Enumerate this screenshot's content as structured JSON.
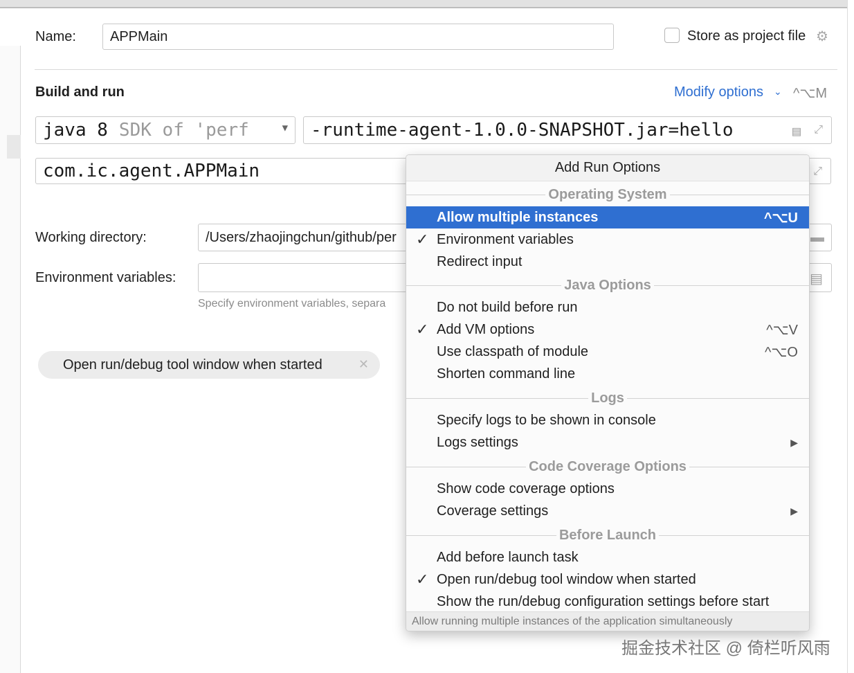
{
  "header": {
    "name_label": "Name:",
    "name_value": "APPMain",
    "store_label": "Store as project file"
  },
  "build": {
    "title": "Build and run",
    "modify_options": "Modify options",
    "modify_shortcut": "^⌥M",
    "jdk_main": "java 8",
    "jdk_hint": "SDK of 'perf",
    "vm_options": "-runtime-agent-1.0.0-SNAPSHOT.jar=hello",
    "main_class": "com.ic.agent.APPMain"
  },
  "working_dir": {
    "label": "Working directory:",
    "value": "/Users/zhaojingchun/github/per"
  },
  "env": {
    "label": "Environment variables:",
    "hint": "Specify environment variables, separa"
  },
  "chip": {
    "label": "Open run/debug tool window when started"
  },
  "popup": {
    "title": "Add Run Options",
    "sections": {
      "os": "Operating System",
      "java": "Java Options",
      "logs": "Logs",
      "coverage": "Code Coverage Options",
      "before": "Before Launch"
    },
    "items": [
      {
        "label": "Allow multiple instances",
        "shortcut": "^⌥U",
        "checked": false,
        "selected": true
      },
      {
        "label": "Environment variables",
        "checked": true
      },
      {
        "label": "Redirect input",
        "checked": false
      },
      {
        "label": "Do not build before run",
        "checked": false
      },
      {
        "label": "Add VM options",
        "shortcut": "^⌥V",
        "checked": true
      },
      {
        "label": "Use classpath of module",
        "shortcut": "^⌥O",
        "checked": false
      },
      {
        "label": "Shorten command line",
        "checked": false
      },
      {
        "label": "Specify logs to be shown in console",
        "checked": false
      },
      {
        "label": "Logs settings",
        "submenu": true,
        "checked": false
      },
      {
        "label": "Show code coverage options",
        "checked": false
      },
      {
        "label": "Coverage settings",
        "submenu": true,
        "checked": false
      },
      {
        "label": "Add before launch task",
        "checked": false
      },
      {
        "label": "Open run/debug tool window when started",
        "checked": true
      },
      {
        "label": "Show the run/debug configuration settings before start",
        "checked": false
      }
    ],
    "footer": "Allow running multiple instances of the application simultaneously"
  },
  "watermark": "掘金技术社区 @ 倚栏听风雨",
  "colors": {
    "accent": "#2f6fd1",
    "selection": "#2f6fd1",
    "background": "#ffffff"
  }
}
